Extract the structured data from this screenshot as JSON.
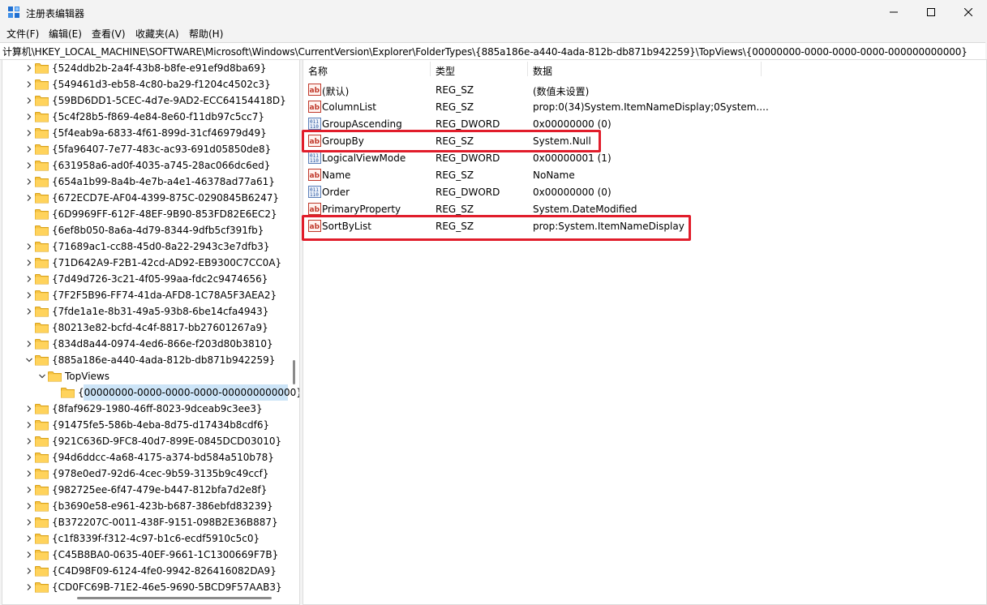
{
  "window": {
    "title": "注册表编辑器",
    "icons": {
      "app": "registry-editor-icon",
      "minimize": "minimize-icon",
      "maximize": "maximize-icon",
      "close": "close-icon"
    }
  },
  "menu": [
    "文件(F)",
    "编辑(E)",
    "查看(V)",
    "收藏夹(A)",
    "帮助(H)"
  ],
  "address": "计算机\\HKEY_LOCAL_MACHINE\\SOFTWARE\\Microsoft\\Windows\\CurrentVersion\\Explorer\\FolderTypes\\{885a186e-a440-4ada-812b-db871b942259}\\TopViews\\{00000000-0000-0000-0000-000000000000}",
  "tree": {
    "items": [
      {
        "label": "{524ddb2b-2a4f-43b8-b8fe-e91ef9d8ba69}",
        "level": 0,
        "chevron": "right"
      },
      {
        "label": "{549461d3-eb58-4c80-ba29-f1204c4502c3}",
        "level": 0,
        "chevron": "right"
      },
      {
        "label": "{59BD6DD1-5CEC-4d7e-9AD2-ECC64154418D}",
        "level": 0,
        "chevron": "right"
      },
      {
        "label": "{5c4f28b5-f869-4e84-8e60-f11db97c5cc7}",
        "level": 0,
        "chevron": "right"
      },
      {
        "label": "{5f4eab9a-6833-4f61-899d-31cf46979d49}",
        "level": 0,
        "chevron": "right"
      },
      {
        "label": "{5fa96407-7e77-483c-ac93-691d05850de8}",
        "level": 0,
        "chevron": "right"
      },
      {
        "label": "{631958a6-ad0f-4035-a745-28ac066dc6ed}",
        "level": 0,
        "chevron": "right"
      },
      {
        "label": "{654a1b99-8a4b-4e7b-a4e1-46378ad77a61}",
        "level": 0,
        "chevron": "right"
      },
      {
        "label": "{672ECD7E-AF04-4399-875C-0290845B6247}",
        "level": 0,
        "chevron": "right"
      },
      {
        "label": "{6D9969FF-612F-48EF-9B90-853FD82E6EC2}",
        "level": 0,
        "chevron": "none"
      },
      {
        "label": "{6ef8b050-8a6a-4d79-8344-9dfb5cf391fb}",
        "level": 0,
        "chevron": "none"
      },
      {
        "label": "{71689ac1-cc88-45d0-8a22-2943c3e7dfb3}",
        "level": 0,
        "chevron": "right"
      },
      {
        "label": "{71D642A9-F2B1-42cd-AD92-EB9300C7CC0A}",
        "level": 0,
        "chevron": "right"
      },
      {
        "label": "{7d49d726-3c21-4f05-99aa-fdc2c9474656}",
        "level": 0,
        "chevron": "right"
      },
      {
        "label": "{7F2F5B96-FF74-41da-AFD8-1C78A5F3AEA2}",
        "level": 0,
        "chevron": "right"
      },
      {
        "label": "{7fde1a1e-8b31-49a5-93b8-6be14cfa4943}",
        "level": 0,
        "chevron": "right"
      },
      {
        "label": "{80213e82-bcfd-4c4f-8817-bb27601267a9}",
        "level": 0,
        "chevron": "none"
      },
      {
        "label": "{834d8a44-0974-4ed6-866e-f203d80b3810}",
        "level": 0,
        "chevron": "right"
      },
      {
        "label": "{885a186e-a440-4ada-812b-db871b942259}",
        "level": 0,
        "chevron": "down"
      },
      {
        "label": "TopViews",
        "level": 1,
        "chevron": "down"
      },
      {
        "label": "{00000000-0000-0000-0000-000000000000}",
        "level": 2,
        "chevron": "none",
        "selected": true
      },
      {
        "label": "{8faf9629-1980-46ff-8023-9dceab9c3ee3}",
        "level": 0,
        "chevron": "right"
      },
      {
        "label": "{91475fe5-586b-4eba-8d75-d17434b8cdf6}",
        "level": 0,
        "chevron": "right"
      },
      {
        "label": "{921C636D-9FC8-40d7-899E-0845DCD03010}",
        "level": 0,
        "chevron": "right"
      },
      {
        "label": "{94d6ddcc-4a68-4175-a374-bd584a510b78}",
        "level": 0,
        "chevron": "right"
      },
      {
        "label": "{978e0ed7-92d6-4cec-9b59-3135b9c49ccf}",
        "level": 0,
        "chevron": "right"
      },
      {
        "label": "{982725ee-6f47-479e-b447-812bfa7d2e8f}",
        "level": 0,
        "chevron": "right"
      },
      {
        "label": "{b3690e58-e961-423b-b687-386ebfd83239}",
        "level": 0,
        "chevron": "right"
      },
      {
        "label": "{B372207C-0011-438F-9151-098B2E36B887}",
        "level": 0,
        "chevron": "right"
      },
      {
        "label": "{c1f8339f-f312-4c97-b1c6-ecdf5910c5c0}",
        "level": 0,
        "chevron": "right"
      },
      {
        "label": "{C45B8BA0-0635-40EF-9661-1C1300669F7B}",
        "level": 0,
        "chevron": "right"
      },
      {
        "label": "{C4D98F09-6124-4fe0-9942-826416082DA9}",
        "level": 0,
        "chevron": "right"
      },
      {
        "label": "{CD0FC69B-71E2-46e5-9690-5BCD9F57AAB3}",
        "level": 0,
        "chevron": "right"
      }
    ]
  },
  "values": {
    "headers": {
      "name": "名称",
      "type": "类型",
      "data": "数据"
    },
    "rows": [
      {
        "name": "(默认)",
        "type": "REG_SZ",
        "data": "(数值未设置)",
        "icon": "string-value-icon"
      },
      {
        "name": "ColumnList",
        "type": "REG_SZ",
        "data": "prop:0(34)System.ItemNameDisplay;0System....",
        "icon": "string-value-icon"
      },
      {
        "name": "GroupAscending",
        "type": "REG_DWORD",
        "data": "0x00000000 (0)",
        "icon": "dword-value-icon"
      },
      {
        "name": "GroupBy",
        "type": "REG_SZ",
        "data": "System.Null",
        "icon": "string-value-icon",
        "highlight": true
      },
      {
        "name": "LogicalViewMode",
        "type": "REG_DWORD",
        "data": "0x00000001 (1)",
        "icon": "dword-value-icon"
      },
      {
        "name": "Name",
        "type": "REG_SZ",
        "data": "NoName",
        "icon": "string-value-icon"
      },
      {
        "name": "Order",
        "type": "REG_DWORD",
        "data": "0x00000000 (0)",
        "icon": "dword-value-icon"
      },
      {
        "name": "PrimaryProperty",
        "type": "REG_SZ",
        "data": "System.DateModified",
        "icon": "string-value-icon"
      },
      {
        "name": "SortByList",
        "type": "REG_SZ",
        "data": "prop:System.ItemNameDisplay",
        "icon": "string-value-icon",
        "highlight": true
      }
    ]
  },
  "colors": {
    "highlight": "#e11d2b",
    "selection": "#cce4f7",
    "folder": "#f6c342"
  }
}
